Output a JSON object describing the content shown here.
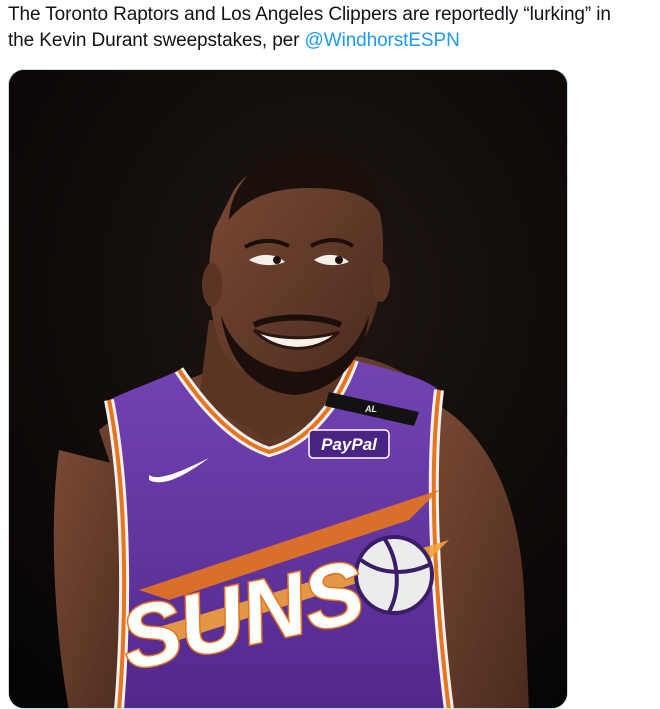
{
  "tweet": {
    "text_line1": "The Toronto Raptors and Los Angeles Clippers are reportedly “lurking” in",
    "text_line2_prefix": "the Kevin Durant sweepstakes, per ",
    "mention": "@WindhorstESPN"
  },
  "photo": {
    "jersey_sponsor": "PayPal",
    "jersey_wordmark": "SUNS",
    "patch_text": "AL"
  },
  "colors": {
    "mention": "#1d9bf0",
    "jersey_purple": "#6a3ca8",
    "jersey_orange": "#e5751f",
    "background": "#0a0708"
  }
}
